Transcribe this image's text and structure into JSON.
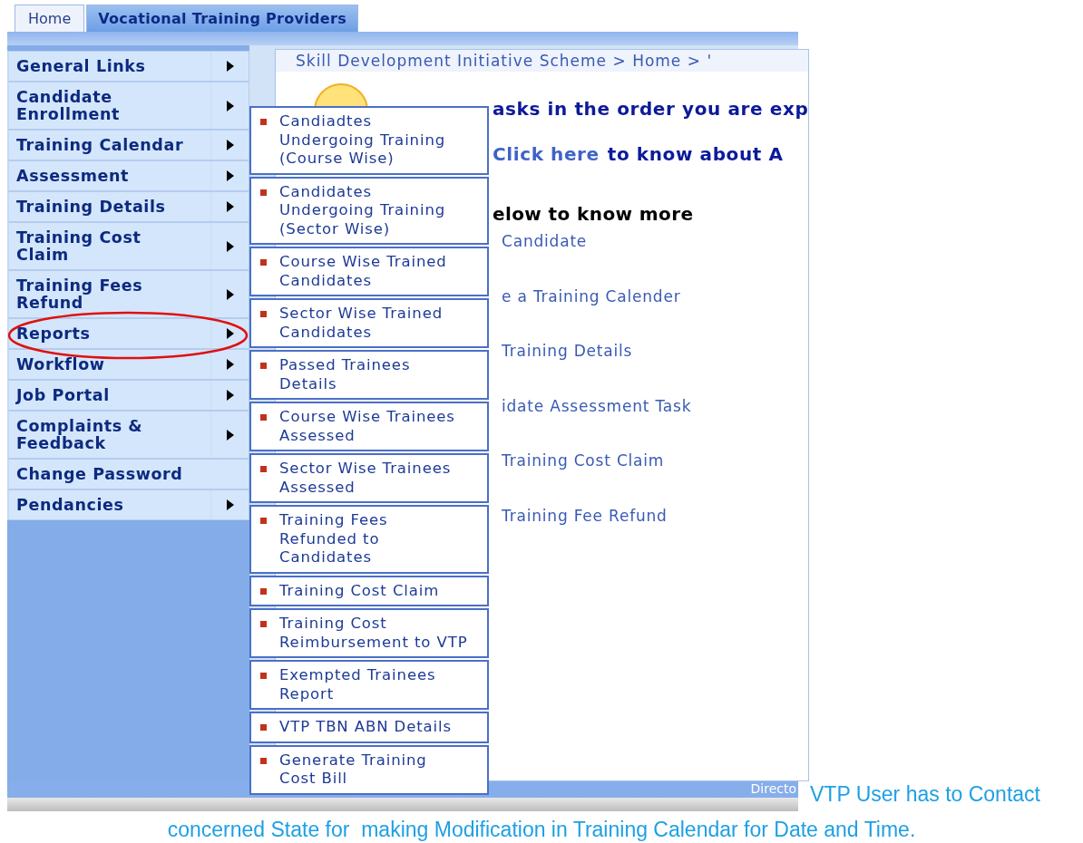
{
  "tabs": [
    {
      "label": "Home",
      "selected": false
    },
    {
      "label": "Vocational Training Providers",
      "selected": true
    }
  ],
  "sidebar": {
    "items": [
      {
        "label": "General Links",
        "arrow": true
      },
      {
        "label": "Candidate\nEnrollment",
        "arrow": true
      },
      {
        "label": "Training Calendar",
        "arrow": true
      },
      {
        "label": "Assessment",
        "arrow": true
      },
      {
        "label": "Training Details",
        "arrow": true
      },
      {
        "label": "Training Cost\nClaim",
        "arrow": true
      },
      {
        "label": "Training Fees\nRefund",
        "arrow": true
      },
      {
        "label": "Reports",
        "arrow": true,
        "circled": true
      },
      {
        "label": "Workflow",
        "arrow": true
      },
      {
        "label": "Job Portal",
        "arrow": true
      },
      {
        "label": "Complaints &\nFeedback",
        "arrow": true
      },
      {
        "label": "Change Password",
        "arrow": false
      },
      {
        "label": "Pendancies",
        "arrow": true
      }
    ]
  },
  "submenu": {
    "items": [
      "Candiadtes\nUndergoing Training\n(Course Wise)",
      "Candidates\nUndergoing Training\n(Sector Wise)",
      "Course Wise Trained\nCandidates",
      "Sector Wise Trained\nCandidates",
      "Passed Trainees\nDetails",
      "Course Wise Trainees\nAssessed",
      "Sector Wise Trainees\nAssessed",
      "Training Fees\nRefunded to\nCandidates",
      "Training Cost Claim",
      "Training Cost\nReimbursement to VTP",
      "Exempted Trainees\nReport",
      "VTP TBN ABN Details",
      "Generate Training\nCost Bill"
    ]
  },
  "content": {
    "breadcrumb": "Skill Development Initiative Scheme > Home > '",
    "headline": "asks in the order you are exp",
    "link_line": {
      "link": "Click here",
      "text": "to know about A"
    },
    "heading": "elow to know more",
    "links": [
      "Candidate",
      "e a Training Calender",
      "Training Details",
      "idate Assessment Task",
      "Training Cost Claim",
      "Training Fee Refund"
    ]
  },
  "footer": {
    "text": "Directo"
  },
  "caption": [
    "VTP User has to Contact",
    "concerned State for  making Modification in Training Calendar for Date and Time."
  ]
}
